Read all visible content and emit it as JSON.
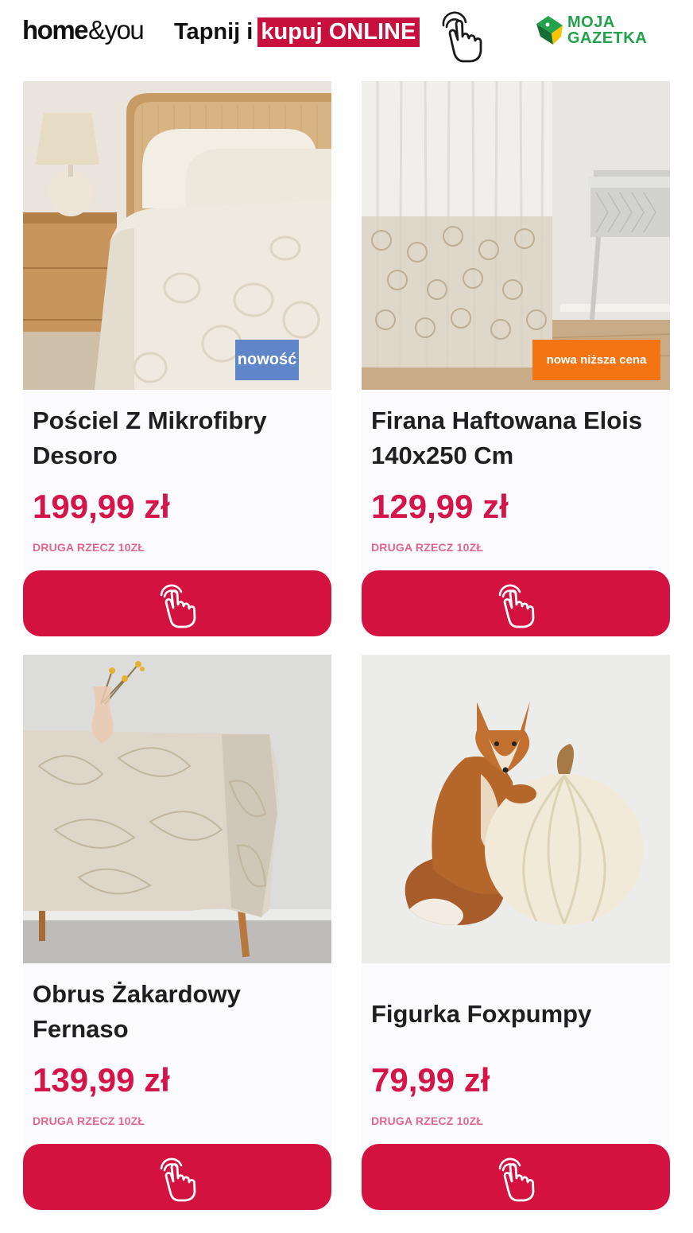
{
  "header": {
    "brand_bold": "home",
    "brand_light": "&you",
    "tagline_prefix": "Tapnij i",
    "tagline_highlight": "kupuj ONLINE",
    "partner_line1": "MOJA",
    "partner_line2": "GAZETKA",
    "tap_icon": "hand-pointer-icon"
  },
  "products": [
    {
      "title": "Pościel Z Mikrofibry Desoro",
      "price": "199,99 zł",
      "promo": "DRUGA RZECZ 10ZŁ",
      "badge": "nowość",
      "button_icon": "hand-pointer-icon"
    },
    {
      "title": "Firana Haftowana Elois 140x250 Cm",
      "price": "129,99 zł",
      "promo": "DRUGA RZECZ 10ZŁ",
      "badge": "nowa niższa cena",
      "button_icon": "hand-pointer-icon"
    },
    {
      "title": "Obrus Żakardowy Fernaso",
      "price": "139,99 zł",
      "promo": "DRUGA RZECZ 10ZŁ",
      "button_icon": "hand-pointer-icon"
    },
    {
      "title": "Figurka Foxpumpy",
      "price": "79,99 zł",
      "promo": "DRUGA RZECZ 10ZŁ",
      "button_icon": "hand-pointer-icon"
    }
  ],
  "colors": {
    "accent_red": "#d3123f",
    "price_red": "#d4154a",
    "promo_pink": "#e2668c",
    "badge_new_blue": "#5f86c9",
    "badge_lower_orange": "#f27413",
    "partner_green": "#23a24d"
  }
}
